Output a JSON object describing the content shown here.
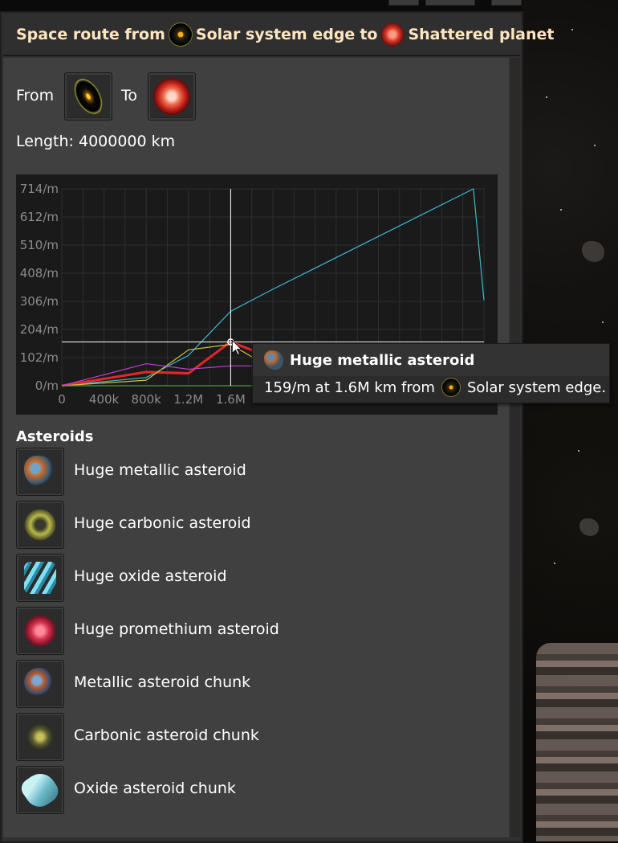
{
  "window": {
    "title_prefix": "Space route from",
    "from_name": "Solar system edge",
    "title_mid": "to",
    "to_name": "Shattered planet"
  },
  "route": {
    "from_label": "From",
    "to_label": "To",
    "length_text": "Length: 4000000 km"
  },
  "chart_data": {
    "type": "line",
    "x_ticks": [
      "0",
      "400k",
      "800k",
      "1.2M",
      "1.6M"
    ],
    "y_ticks": [
      "0/m",
      "102/m",
      "204/m",
      "306/m",
      "408/m",
      "510/m",
      "612/m",
      "714/m"
    ],
    "xlim": [
      0,
      4000000
    ],
    "ylim": [
      0,
      714
    ],
    "grid": true,
    "crosshair": {
      "x": 1600000,
      "y": 159
    },
    "series": [
      {
        "color": "#3fb8d0",
        "x": [
          0,
          800000,
          1200000,
          1600000,
          2000000,
          3900000,
          4000000
        ],
        "values": [
          0,
          30,
          110,
          270,
          350,
          714,
          310
        ]
      },
      {
        "color": "#e02828",
        "x": [
          0,
          800000,
          1200000,
          1600000,
          2000000,
          2500000
        ],
        "values": [
          0,
          50,
          45,
          159,
          100,
          10
        ]
      },
      {
        "color": "#d0c040",
        "x": [
          0,
          800000,
          1200000,
          1600000,
          2000000,
          2400000
        ],
        "values": [
          0,
          20,
          130,
          150,
          60,
          0
        ]
      },
      {
        "color": "#c040d0",
        "x": [
          0,
          800000,
          1200000,
          1600000,
          2000000,
          2400000
        ],
        "values": [
          0,
          80,
          60,
          72,
          72,
          72
        ]
      },
      {
        "color": "#40a040",
        "x": [
          0,
          1600000,
          2000000,
          2400000
        ],
        "values": [
          0,
          0,
          0,
          0
        ]
      }
    ]
  },
  "tooltip": {
    "title": "Huge metallic asteroid",
    "line_value": "159/m at 1.6M km from",
    "line_place": "Solar system edge."
  },
  "asteroids": {
    "title": "Asteroids",
    "items": [
      {
        "label": "Huge metallic asteroid",
        "icon": "huge-metallic-asteroid-icon"
      },
      {
        "label": "Huge carbonic asteroid",
        "icon": "huge-carbonic-asteroid-icon"
      },
      {
        "label": "Huge oxide asteroid",
        "icon": "huge-oxide-asteroid-icon"
      },
      {
        "label": "Huge promethium asteroid",
        "icon": "huge-promethium-asteroid-icon"
      },
      {
        "label": "Metallic asteroid chunk",
        "icon": "metallic-asteroid-chunk-icon"
      },
      {
        "label": "Carbonic asteroid chunk",
        "icon": "carbonic-asteroid-chunk-icon"
      },
      {
        "label": "Oxide asteroid chunk",
        "icon": "oxide-asteroid-chunk-icon"
      }
    ]
  }
}
